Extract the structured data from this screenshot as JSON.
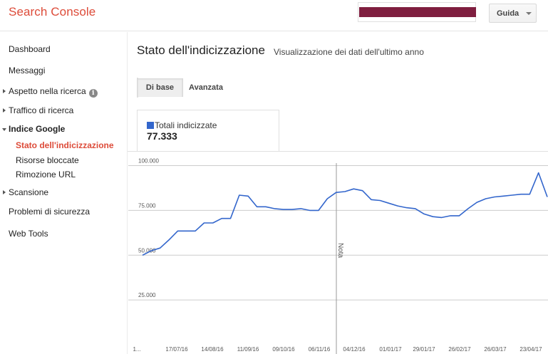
{
  "header": {
    "logo": "Search Console",
    "help_label": "Guida",
    "site_selector_color": "#7f1e3f"
  },
  "sidebar": {
    "items": [
      {
        "label": "Dashboard"
      },
      {
        "label": "Messaggi"
      },
      {
        "label": "Aspetto nella ricerca",
        "info_icon": "i"
      },
      {
        "label": "Traffico di ricerca"
      },
      {
        "label": "Indice Google"
      },
      {
        "label": "Stato dell'indicizzazione"
      },
      {
        "label": "Risorse bloccate"
      },
      {
        "label": "Rimozione URL"
      },
      {
        "label": "Scansione"
      },
      {
        "label": "Problemi di sicurezza"
      },
      {
        "label": "Web Tools"
      }
    ]
  },
  "main": {
    "title": "Stato dell'indicizzazione",
    "subtitle": "Visualizzazione dei dati dell'ultimo anno",
    "tabs": [
      {
        "label": "Di base"
      },
      {
        "label": "Avanzata"
      }
    ],
    "legend": {
      "label": "Totali indicizzate",
      "value": "77.333",
      "color": "#3366cc"
    }
  },
  "colors": {
    "accent": "#dd4b39",
    "series": "#3366cc"
  },
  "chart_data": {
    "type": "line",
    "ylim": [
      0,
      100000
    ],
    "y_ticks": [
      {
        "value": 25000,
        "label": "25.000"
      },
      {
        "value": 50000,
        "label": "50.000"
      },
      {
        "value": 75000,
        "label": "75.000"
      },
      {
        "value": 100000,
        "label": "100.000"
      }
    ],
    "x_tick_labels": [
      "1...",
      "17/07/16",
      "14/08/16",
      "11/09/16",
      "09/10/16",
      "06/11/16",
      "04/12/16",
      "01/01/17",
      "29/01/17",
      "26/02/17",
      "26/03/17",
      "23/04/17"
    ],
    "annotation": {
      "label": "Nota",
      "index": 23
    },
    "series": [
      {
        "color": "#3366cc",
        "values": [
          50000,
          52500,
          54000,
          58500,
          63500,
          63500,
          63500,
          68000,
          68000,
          70500,
          70500,
          83500,
          83000,
          77000,
          77000,
          76000,
          75500,
          75500,
          76000,
          75000,
          75000,
          81500,
          85000,
          85500,
          87000,
          86000,
          81000,
          80500,
          79000,
          77500,
          76500,
          76000,
          73000,
          71500,
          71000,
          72000,
          72000,
          76000,
          79500,
          81500,
          82500,
          83000,
          83500,
          84000,
          84000,
          96000,
          82500
        ]
      }
    ]
  }
}
